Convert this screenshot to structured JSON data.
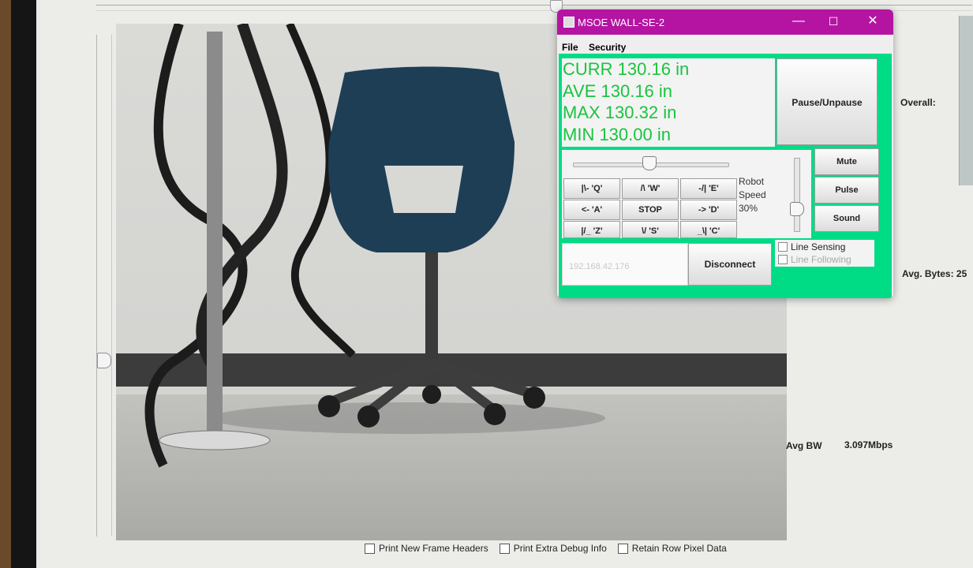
{
  "background_app": {
    "labels": {
      "overall": "Overall:",
      "avg_bytes": "Avg. Bytes: 25",
      "avg_bw_label": "Avg BW",
      "avg_bw_value": "3.097Mbps"
    },
    "checkboxes": [
      {
        "label": "Print New Frame Headers",
        "checked": false
      },
      {
        "label": "Print Extra Debug Info",
        "checked": false
      },
      {
        "label": "Retain Row Pixel Data",
        "checked": false
      }
    ]
  },
  "window": {
    "title": "MSOE WALL-SE-2",
    "titlebar_color": "#b514a2",
    "client_color": "#00dc86",
    "controls": {
      "minimize": "—",
      "maximize": "☐",
      "close": "✕"
    },
    "menu": [
      "File",
      "Security"
    ],
    "readout": {
      "curr": "CURR 130.16 in",
      "ave": "AVE 130.16 in",
      "max": "MAX 130.32 in",
      "min": "MIN 130.00 in",
      "color": "#19c43e"
    },
    "pause_button": "Pause/Unpause",
    "direction_buttons": [
      [
        "|\\- 'Q'",
        "/\\ 'W'",
        "-/| 'E'"
      ],
      [
        "<- 'A'",
        "STOP",
        "-> 'D'"
      ],
      [
        "|/_ 'Z'",
        "\\/ 'S'",
        "_\\| 'C'"
      ]
    ],
    "robot_speed": {
      "line1": "Robot",
      "line2": "Speed",
      "value": "30%"
    },
    "sound_buttons": [
      "Mute",
      "Pulse",
      "Sound"
    ],
    "ip_value": "192.168.42.176",
    "disconnect_button": "Disconnect",
    "line_options": [
      {
        "label": "Line Sensing",
        "checked": false
      },
      {
        "label": "Line Following",
        "checked": false
      }
    ]
  }
}
